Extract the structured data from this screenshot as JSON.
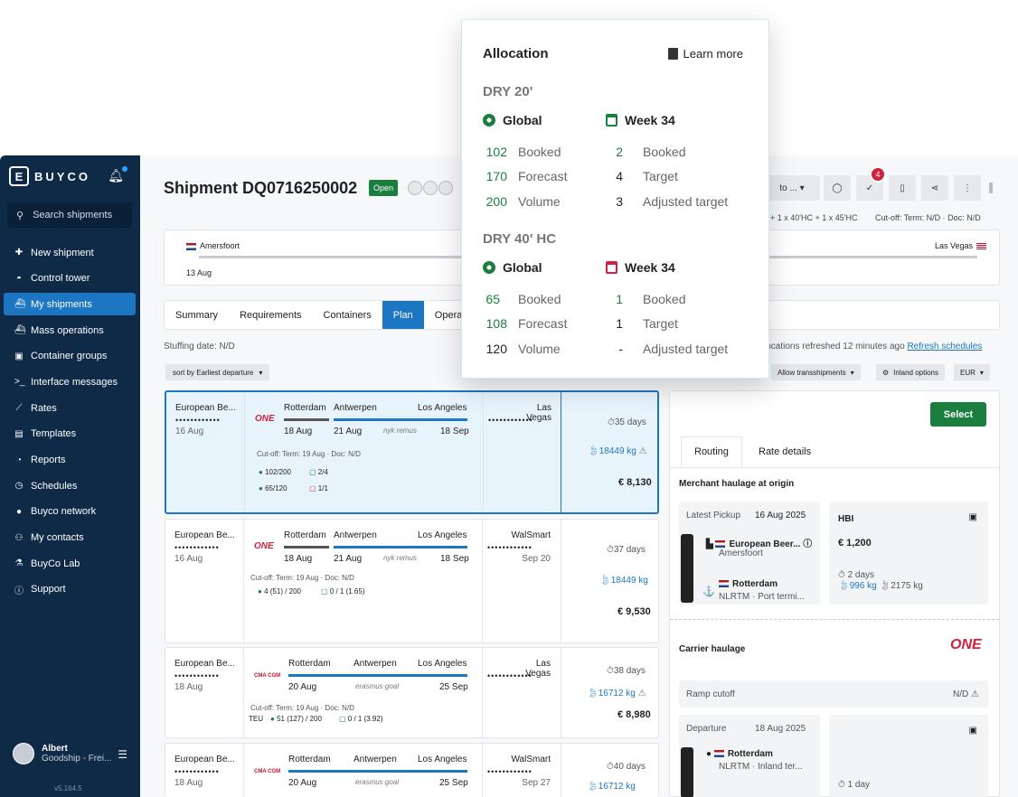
{
  "colors": {
    "sidebar": "#0e2a47",
    "accent": "#1c76c2",
    "success": "#1a7f3e",
    "danger": "#d0213e"
  },
  "sidebar": {
    "brand": "BUYCO",
    "search_label": "Search shipments",
    "items": [
      {
        "label": "New shipment",
        "icon": "plus-icon"
      },
      {
        "label": "Control tower",
        "icon": "gauge-icon"
      },
      {
        "label": "My shipments",
        "icon": "ship-icon"
      },
      {
        "label": "Mass operations",
        "icon": "ship-icon"
      },
      {
        "label": "Container groups",
        "icon": "container-icon"
      },
      {
        "label": "Interface messages",
        "icon": "terminal-icon"
      },
      {
        "label": "Rates",
        "icon": "chart-icon"
      },
      {
        "label": "Templates",
        "icon": "template-icon"
      },
      {
        "label": "Reports",
        "icon": "pie-icon"
      },
      {
        "label": "Schedules",
        "icon": "clock-icon"
      },
      {
        "label": "Buyco network",
        "icon": "globe-icon"
      },
      {
        "label": "My contacts",
        "icon": "users-icon"
      },
      {
        "label": "BuyCo Lab",
        "icon": "flask-icon"
      },
      {
        "label": "Support",
        "icon": "info-icon"
      }
    ],
    "user_name": "Albert",
    "user_org": "Goodship - Frei...",
    "version": "v5.164.5"
  },
  "header": {
    "title": "Shipment DQ0716250002",
    "status": "Open",
    "toolbar_move": "to ...",
    "badge_count": "4",
    "route_summary": "/ + 1 x 40'HC + 1 x 45'HC",
    "cutoff": "Cut-off: Term: N/D · Doc: N/D"
  },
  "timeline": {
    "origin": "Amersfoort",
    "destination": "Las Vegas",
    "date": "13 Aug"
  },
  "tabs": [
    "Summary",
    "Requirements",
    "Containers",
    "Plan",
    "Opera"
  ],
  "stuffing": "Stuffing date: N/D",
  "refreshed": "locations refreshed 12 minutes ago",
  "refresh_link": "Refresh schedules",
  "sort_label": "sort by Earliest departure",
  "options": {
    "transship": "Allow transshipments",
    "inland": "Inland options",
    "currency": "EUR"
  },
  "cards": [
    {
      "origin": "European Be...",
      "odots": "••••••••••••",
      "odate": "16 Aug",
      "carrier": "ONE",
      "leg1_from": "Rotterdam",
      "leg1_date": "18 Aug",
      "leg2_from": "Antwerpen",
      "leg2_date": "21 Aug",
      "vessel": "nyk remus",
      "leg3_to": "Los Angeles",
      "leg3_date": "18 Sep",
      "dest": "Las Vegas",
      "ddots": "••••••••••••",
      "ddate": "",
      "cutoff": "Cut-off: Term: 19 Aug · Doc: N/D",
      "alloc1": "102/200",
      "alloc2": "2/4",
      "alloc3": "65/120",
      "alloc4": "1/1",
      "days": "35 days",
      "kg": "18449 kg",
      "price": "€ 8,130"
    },
    {
      "origin": "European Be...",
      "odots": "••••••••••••",
      "odate": "16 Aug",
      "carrier": "ONE",
      "leg1_from": "Rotterdam",
      "leg1_date": "18 Aug",
      "leg2_from": "Antwerpen",
      "leg2_date": "21 Aug",
      "vessel": "nyk remus",
      "leg3_to": "Los Angeles",
      "leg3_date": "18 Sep",
      "dest": "WalSmart",
      "ddots": "••••••••••••",
      "ddate": "Sep 20",
      "cutoff": "Cut-off: Term: 19 Aug · Doc: N/D",
      "alloc1": "4 (51) / 200",
      "alloc2": "0 / 1 (1.65)",
      "days": "37 days",
      "kg": "18449 kg",
      "price": "€ 9,530"
    },
    {
      "origin": "European Be...",
      "odots": "••••••••••••",
      "odate": "18 Aug",
      "carrier": "CMA CGM",
      "leg1_from": "Rotterdam",
      "leg1_date": "20 Aug",
      "leg2_from": "Antwerpen",
      "vessel": "erasmus goal",
      "leg3_to": "Los Angeles",
      "leg3_date": "25 Sep",
      "dest": "Las Vegas",
      "ddots": "••••••••••••",
      "ddate": "",
      "cutoff": "Cut-off: Term: 19 Aug · Doc: N/D",
      "teu": "TEU",
      "alloc1": "51 (127) / 200",
      "alloc2": "0 / 1 (3.92)",
      "days": "38 days",
      "kg": "16712 kg",
      "price": "€ 8,980"
    },
    {
      "origin": "European Be...",
      "odots": "••••••••••••",
      "odate": "18 Aug",
      "carrier": "CMA CGM",
      "leg1_from": "Rotterdam",
      "leg1_date": "20 Aug",
      "leg2_from": "Antwerpen",
      "vessel": "erasmus goal",
      "leg3_to": "Los Angeles",
      "leg3_date": "25 Sep",
      "dest": "WalSmart",
      "ddots": "••••••••••••",
      "ddate": "Sep 27",
      "days": "40 days",
      "kg": "16712 kg"
    }
  ],
  "right": {
    "select": "Select",
    "tab_routing": "Routing",
    "tab_rates": "Rate details",
    "merchant": "Merchant haulage at origin",
    "latest_pickup": "Latest Pickup",
    "pickup_date": "16 Aug 2025",
    "stop1": "European Beer...",
    "stop1_sub": "Amersfoort",
    "stop2": "Rotterdam",
    "stop2_sub": "NLRTM · Port termi...",
    "hbi": "HBI",
    "hbi_price": "€ 1,200",
    "hbi_days": "2 days",
    "hbi_kg1": "996 kg",
    "hbi_kg2": "2175 kg",
    "carrier_haulage": "Carrier haulage",
    "carrier": "ONE",
    "ramp": "Ramp cutoff",
    "ramp_val": "N/D",
    "departure": "Departure",
    "departure_date": "18 Aug 2025",
    "stop3": "Rotterdam",
    "stop3_sub": "NLRTM · Inland ter...",
    "dep_days": "1 day"
  },
  "popup": {
    "title": "Allocation",
    "learn_more": "Learn more",
    "sections": [
      {
        "name": "DRY 20'",
        "global_label": "Global",
        "week_label": "Week 34",
        "global": [
          {
            "n": "102",
            "l": "Booked"
          },
          {
            "n": "170",
            "l": "Forecast"
          },
          {
            "n": "200",
            "l": "Volume"
          }
        ],
        "week": [
          {
            "n": "2",
            "l": "Booked"
          },
          {
            "n": "4",
            "l": "Target"
          },
          {
            "n": "3",
            "l": "Adjusted target"
          }
        ]
      },
      {
        "name": "DRY 40' HC",
        "global_label": "Global",
        "week_label": "Week 34",
        "global": [
          {
            "n": "65",
            "l": "Booked"
          },
          {
            "n": "108",
            "l": "Forecast"
          },
          {
            "n": "120",
            "l": "Volume"
          }
        ],
        "week": [
          {
            "n": "1",
            "l": "Booked"
          },
          {
            "n": "1",
            "l": "Target"
          },
          {
            "n": "-",
            "l": "Adjusted target"
          }
        ]
      }
    ]
  }
}
